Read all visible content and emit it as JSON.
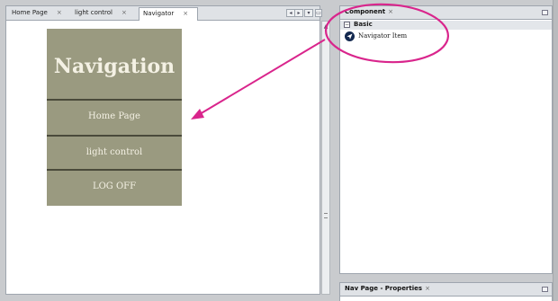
{
  "editor": {
    "tabs": [
      {
        "label": "Home Page",
        "close": "×",
        "active": false
      },
      {
        "label": "light control",
        "close": "×",
        "active": false
      },
      {
        "label": "Navigator",
        "close": "×",
        "active": true
      }
    ],
    "controls": [
      "◂",
      "▸",
      "▾",
      "▭"
    ]
  },
  "navigation_preview": {
    "title": "Navigation",
    "items": [
      "Home Page",
      "light control",
      "LOG OFF"
    ],
    "background_color": "#9a9a80",
    "text_color": "#f4f1e4"
  },
  "scrollbar": {
    "up": "▲",
    "grip": "≡"
  },
  "component_panel": {
    "title": "Component",
    "close": "×",
    "group_toggle": "−",
    "group_label": "Basic",
    "items": [
      {
        "label": "Navigator Item",
        "icon": "navigator-arrow-icon"
      }
    ]
  },
  "properties_panel": {
    "title": "Nav Page - Properties",
    "close": "×"
  },
  "annotation": {
    "color": "#d9258c"
  }
}
